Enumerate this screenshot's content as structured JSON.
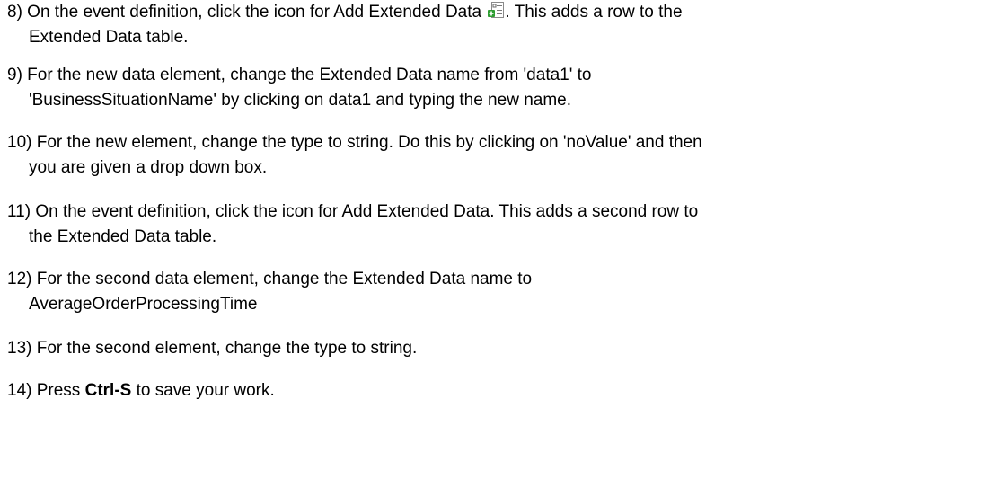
{
  "steps": [
    {
      "line1_before_icon": "8) On the event definition, click the icon for Add Extended Data ",
      "line1_after_icon": ". This adds a row to the",
      "line2": "Extended Data table."
    },
    {
      "line1": "9) For the new data element, change the Extended Data name from 'data1' to",
      "line2": "'BusinessSituationName' by clicking on data1 and typing the new name."
    },
    {
      "line1": "10) For the new element, change the type to string. Do this by clicking on 'noValue' and then",
      "line2": "you are given a drop down box."
    },
    {
      "line1": "11) On the event definition, click the icon for Add Extended Data. This adds a second row to",
      "line2": "the Extended Data table."
    },
    {
      "line1": "12) For the second data element, change the Extended Data name to",
      "line2": "AverageOrderProcessingTime"
    },
    {
      "line1": "13) For the second element, change the type to string."
    },
    {
      "prefix": "14) Press ",
      "bold": "Ctrl-S",
      "suffix": " to save your work."
    }
  ],
  "icon": "add-extended-data-icon"
}
